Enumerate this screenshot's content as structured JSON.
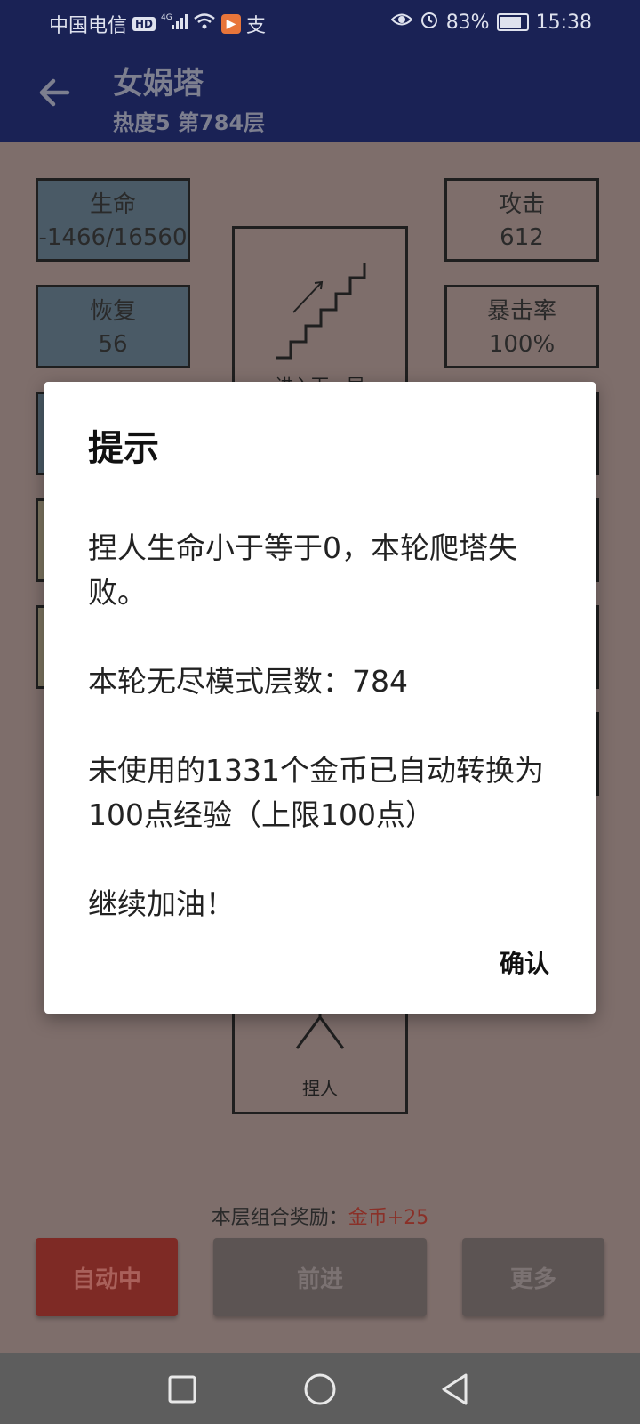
{
  "status_bar": {
    "carrier": "中国电信",
    "hd_badge": "HD",
    "network": "4G",
    "app_icon_glyph": "▶",
    "extra_glyph": "支",
    "battery_percent": "83%",
    "time": "15:38"
  },
  "app_bar": {
    "title": "女娲塔",
    "subtitle": "热度5 第784层"
  },
  "stats": {
    "life_label": "生命",
    "life_value": "-1466/16560",
    "recover_label": "恢复",
    "recover_value": "56",
    "attack_label": "攻击",
    "attack_value": "612",
    "crit_label": "暴击率",
    "crit_value": "100%"
  },
  "board": {
    "stairs_label": "进入下一层",
    "player_label": "捏人"
  },
  "reward": {
    "label": "本层组合奖励：",
    "value": "金币+25"
  },
  "buttons": {
    "auto": "自动中",
    "forward": "前进",
    "more": "更多"
  },
  "dialog": {
    "title": "提示",
    "message": "捏人生命小于等于0，本轮爬塔失败。\n\n本轮无尽模式层数：784\n\n未使用的1331个金币已自动转换为100点经验（上限100点）\n\n继续加油！",
    "confirm": "确认"
  },
  "colors": {
    "app_bar": "#1a2255",
    "dimmed_background": "#7e6e6b",
    "auto_button": "#7e2a25",
    "dialog": "#ffffff"
  },
  "icons": {
    "back": "arrow-left-icon",
    "stairs": "stairs-icon",
    "nav_recent": "square-icon",
    "nav_home": "circle-icon",
    "nav_back": "triangle-back-icon"
  }
}
